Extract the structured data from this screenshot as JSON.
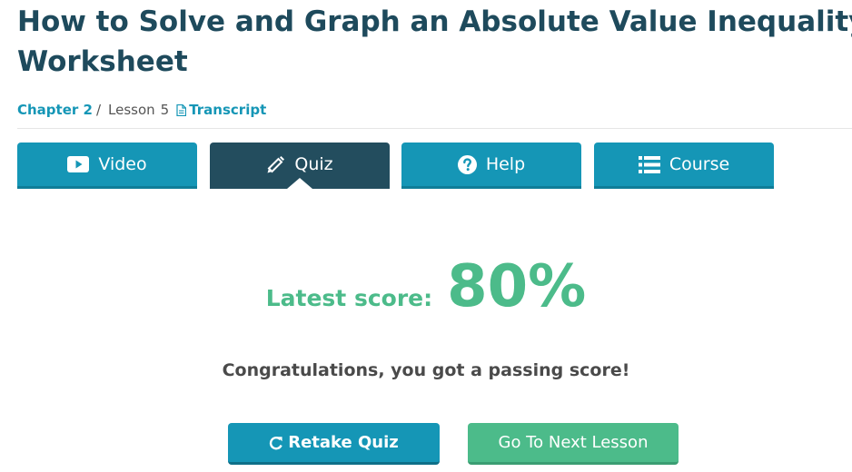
{
  "header": {
    "title": "How to Solve and Graph an Absolute Value Inequality - Quiz & Worksheet"
  },
  "breadcrumb": {
    "chapter": "Chapter 2",
    "separator": "/",
    "lesson_label": "Lesson",
    "lesson_number": "5",
    "transcript": "Transcript"
  },
  "tabs": [
    {
      "label": "Video",
      "icon": "video-icon",
      "active": false
    },
    {
      "label": "Quiz",
      "icon": "pencil-icon",
      "active": true
    },
    {
      "label": "Help",
      "icon": "question-circle-icon",
      "active": false
    },
    {
      "label": "Course",
      "icon": "list-icon",
      "active": false
    }
  ],
  "result": {
    "score_label": "Latest score:",
    "score_value": "80%",
    "message": "Congratulations, you got a passing score!"
  },
  "actions": {
    "retake_label": "Retake Quiz",
    "next_label": "Go To Next Lesson"
  },
  "colors": {
    "title": "#1e4a5c",
    "accent": "#1596b6",
    "active_tab": "#234d5e",
    "success": "#4cbb8a"
  }
}
